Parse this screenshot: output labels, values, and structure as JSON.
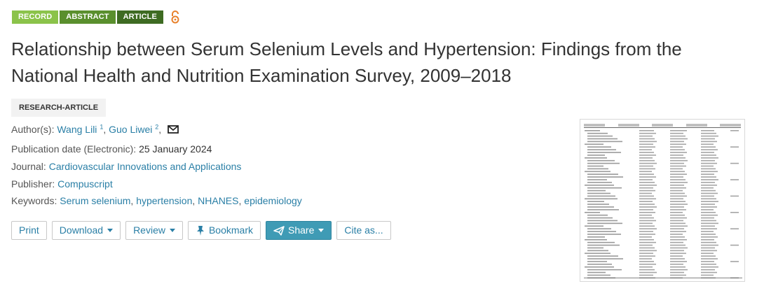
{
  "badges": [
    "RECORD",
    "ABSTRACT",
    "ARTICLE"
  ],
  "open_access_icon": "open-access-lock-icon",
  "title": "Relationship between Serum Selenium Levels and Hypertension: Findings from the National Health and Nutrition Examination Survey, 2009–2018",
  "article_type": "RESEARCH-ARTICLE",
  "authors": {
    "label": "Author(s):",
    "list": [
      {
        "name": "Wang Lili",
        "sup": "1"
      },
      {
        "name": "Guo Liwei",
        "sup": "2"
      }
    ],
    "separator": ",",
    "trailing": ",",
    "mail_icon": "envelope-icon"
  },
  "publication": {
    "label": "Publication date (Electronic):",
    "value": "25 January 2024"
  },
  "journal": {
    "label": "Journal:",
    "value": "Cardiovascular Innovations and Applications"
  },
  "publisher": {
    "label": "Publisher:",
    "value": "Compuscript"
  },
  "keywords": {
    "label": "Keywords:",
    "items": [
      "Serum selenium",
      "hypertension",
      "NHANES",
      "epidemiology"
    ],
    "separator": ","
  },
  "toolbar": {
    "print": "Print",
    "download": "Download",
    "review": "Review",
    "bookmark": "Bookmark",
    "share": "Share",
    "cite": "Cite as..."
  },
  "colors": {
    "badge_record": "#8bc34a",
    "badge_abstract": "#5a8f2d",
    "badge_article": "#3e6b22",
    "link": "#2a7fa6",
    "share_button": "#3f9bb5",
    "open_access": "#e8802a"
  }
}
